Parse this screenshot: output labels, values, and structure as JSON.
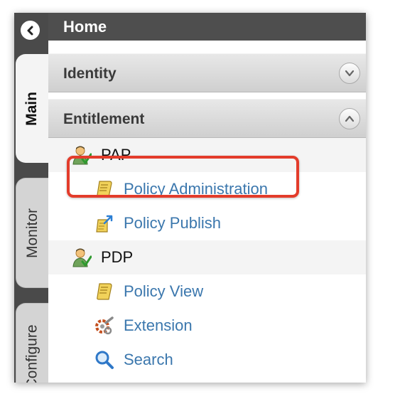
{
  "tabs": {
    "main": "Main",
    "monitor": "Monitor",
    "configure": "Configure"
  },
  "header": {
    "title": "Home"
  },
  "sections": {
    "identity": {
      "label": "Identity",
      "state": "collapsed"
    },
    "entitlement": {
      "label": "Entitlement",
      "state": "expanded"
    }
  },
  "menu": {
    "pap": {
      "label": "PAP",
      "items": [
        {
          "label": "Policy Administration",
          "icon": "scroll-icon",
          "highlighted": true
        },
        {
          "label": "Policy Publish",
          "icon": "publish-icon"
        }
      ]
    },
    "pdp": {
      "label": "PDP",
      "items": [
        {
          "label": "Policy View",
          "icon": "scroll-icon"
        },
        {
          "label": "Extension",
          "icon": "gear-icon"
        },
        {
          "label": "Search",
          "icon": "magnifier-icon"
        }
      ]
    }
  },
  "colors": {
    "highlight_border": "#e33c2b",
    "link": "#3b77ad",
    "header_bg": "#4e4e4e"
  }
}
